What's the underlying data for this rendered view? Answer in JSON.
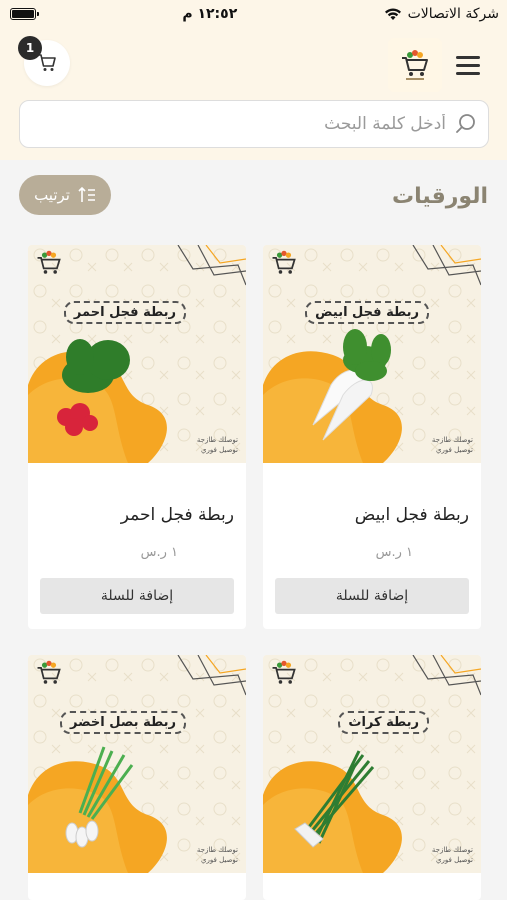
{
  "status_bar": {
    "carrier": "شركة الاتصالات",
    "time": "١٢:٥٢ م",
    "battery_level": 1.0
  },
  "header": {
    "cart_count": "1",
    "search": {
      "placeholder": "أدخل كلمة البحث",
      "value": ""
    }
  },
  "section": {
    "title": "الورقيات",
    "sort_label": "ترتيب"
  },
  "products": [
    {
      "tag": "ربطة فجل ابيض",
      "name": "ربطة فجل ابيض",
      "price": "١ ر.س",
      "button": "إضافة للسلة",
      "note_line1": "توصلك طازجة",
      "note_line2": "توصيل فوري"
    },
    {
      "tag": "ربطة فجل احمر",
      "name": "ربطة فجل احمر",
      "price": "١ ر.س",
      "button": "إضافة للسلة",
      "note_line1": "توصلك طازجة",
      "note_line2": "توصيل فوري"
    },
    {
      "tag": "ربطة كراث",
      "name": "",
      "price": "",
      "button": "",
      "note_line1": "توصلك طازجة",
      "note_line2": "توصيل فوري"
    },
    {
      "tag": "ربطة بصل اخضر",
      "name": "",
      "price": "",
      "button": "",
      "note_line1": "توصلك طازجة",
      "note_line2": "توصيل فوري"
    }
  ],
  "colors": {
    "header_bg": "#fdf6e8",
    "sort_bg": "#b8ad98",
    "title": "#8b8472",
    "accent_orange": "#f5a623"
  },
  "icons": [
    "battery-icon",
    "wifi-icon",
    "cart-icon",
    "logo-icon",
    "menu-icon",
    "search-icon",
    "sort-icon"
  ]
}
